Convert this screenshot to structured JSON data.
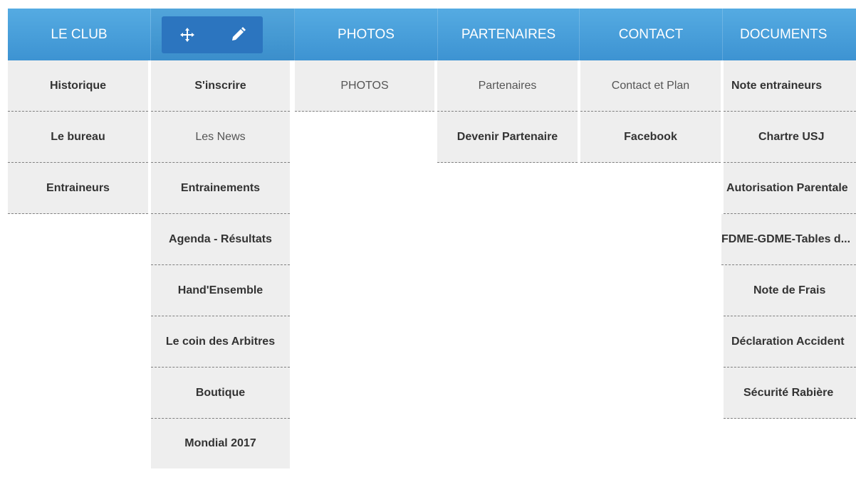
{
  "nav": {
    "le_club": "LE CLUB",
    "photos": "PHOTOS",
    "partenaires": "PARTENAIRES",
    "contact": "CONTACT",
    "documents": "DOCUMENTS"
  },
  "edit_toolbar": {
    "move_icon": "move-arrows-icon",
    "edit_icon": "pencil-icon"
  },
  "submenus": {
    "le_club": [
      "Historique",
      "Le bureau",
      "Entraineurs"
    ],
    "edit": [
      "S'inscrire",
      "Les News",
      "Entrainements",
      "Agenda - Résultats",
      "Hand'Ensemble",
      "Le coin des Arbitres",
      "Boutique",
      "Mondial 2017"
    ],
    "photos": [
      "PHOTOS"
    ],
    "partenaires": [
      "Partenaires",
      "Devenir Partenaire"
    ],
    "contact": [
      "Contact et Plan",
      "Facebook"
    ],
    "documents": [
      "Note entraineurs",
      "Chartre USJ",
      "Autorisation Parentale",
      "FDME-GDME-Tables d...",
      "Note de Frais",
      "Déclaration Accident",
      "Sécurité Rabière"
    ]
  },
  "colors": {
    "nav_top": "#55abe2",
    "nav_bottom": "#3d93d2",
    "toolbar": "#2c75bf",
    "menu_bg": "#eeeeee"
  }
}
